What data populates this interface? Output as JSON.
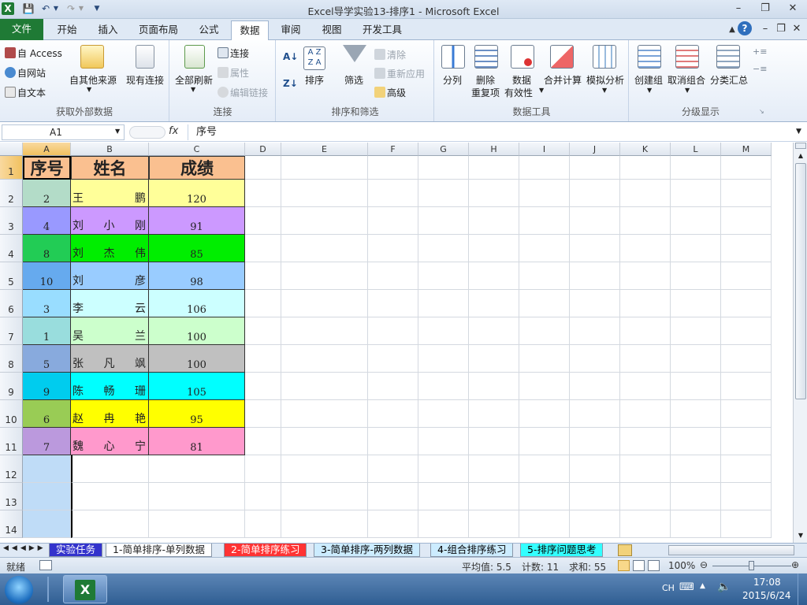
{
  "window": {
    "title": "Excel导学实验13-排序1  -  Microsoft Excel"
  },
  "tabs": [
    {
      "label": "文件"
    },
    {
      "label": "开始"
    },
    {
      "label": "插入"
    },
    {
      "label": "页面布局"
    },
    {
      "label": "公式"
    },
    {
      "label": "数据"
    },
    {
      "label": "审阅"
    },
    {
      "label": "视图"
    },
    {
      "label": "开发工具"
    }
  ],
  "ribbon": {
    "ext": {
      "access": "自 Access",
      "web": "自网站",
      "text": "自文本",
      "other": "自其他来源",
      "existing": "现有连接",
      "label": "获取外部数据"
    },
    "conn": {
      "refresh": "全部刷新",
      "connections": "连接",
      "properties": "属性",
      "edit_links": "编辑链接",
      "label": "连接"
    },
    "sort": {
      "sort": "排序",
      "filter": "筛选",
      "clear": "清除",
      "reapply": "重新应用",
      "advanced": "高级",
      "label": "排序和筛选"
    },
    "tools": {
      "split": "分列",
      "remove_dup_1": "删除",
      "remove_dup_2": "重复项",
      "validation_1": "数据",
      "validation_2": "有效性",
      "consolidate": "合并计算",
      "whatif": "模拟分析",
      "label": "数据工具"
    },
    "outline": {
      "group": "创建组",
      "ungroup": "取消组合",
      "subtotal": "分类汇总",
      "label": "分级显示"
    }
  },
  "formula": {
    "namebox": "A1",
    "fx": "fx",
    "content": "序号"
  },
  "columns": [
    "A",
    "B",
    "C",
    "D",
    "E",
    "F",
    "G",
    "H",
    "I",
    "J",
    "K",
    "L",
    "M"
  ],
  "rows": [
    "1",
    "2",
    "3",
    "4",
    "5",
    "6",
    "7",
    "8",
    "9",
    "10",
    "11",
    "12",
    "13",
    "14"
  ],
  "table": {
    "headers": [
      "序号",
      "姓名",
      "成绩"
    ],
    "header_color": "#fac090",
    "data": [
      {
        "id": "2",
        "name": [
          "王",
          "",
          "鹏"
        ],
        "score": "120",
        "color_a": "#b3dcc8",
        "color_b": "#ffff99",
        "color_c": "#ffff99"
      },
      {
        "id": "4",
        "name": [
          "刘",
          "小",
          "刚"
        ],
        "score": "91",
        "color_a": "#9999ff",
        "color_b": "#cc99ff",
        "color_c": "#cc99ff"
      },
      {
        "id": "8",
        "name": [
          "刘",
          "杰",
          "伟"
        ],
        "score": "85",
        "color_a": "#22cc55",
        "color_b": "#00ee00",
        "color_c": "#00ee00"
      },
      {
        "id": "10",
        "name": [
          "刘",
          "",
          "彦"
        ],
        "score": "98",
        "color_a": "#66aaee",
        "color_b": "#99ccff",
        "color_c": "#99ccff"
      },
      {
        "id": "3",
        "name": [
          "李",
          "",
          "云"
        ],
        "score": "106",
        "color_a": "#99ddff",
        "color_b": "#ccffff",
        "color_c": "#ccffff"
      },
      {
        "id": "1",
        "name": [
          "吴",
          "",
          "兰"
        ],
        "score": "100",
        "color_a": "#99dddd",
        "color_b": "#ccffcc",
        "color_c": "#ccffcc"
      },
      {
        "id": "5",
        "name": [
          "张",
          "凡",
          "飒"
        ],
        "score": "100",
        "color_a": "#88aadd",
        "color_b": "#c0c0c0",
        "color_c": "#c0c0c0"
      },
      {
        "id": "9",
        "name": [
          "陈",
          "畅",
          "珊"
        ],
        "score": "105",
        "color_a": "#00ccee",
        "color_b": "#00ffff",
        "color_c": "#00ffff"
      },
      {
        "id": "6",
        "name": [
          "赵",
          "冉",
          "艳"
        ],
        "score": "95",
        "color_a": "#99cc55",
        "color_b": "#ffff00",
        "color_c": "#ffff00"
      },
      {
        "id": "7",
        "name": [
          "魏",
          "心",
          "宁"
        ],
        "score": "81",
        "color_a": "#bb99dd",
        "color_b": "#ff99cc",
        "color_c": "#ff99cc"
      }
    ]
  },
  "sheets": [
    {
      "label": "实验任务",
      "bg": "#3333cc",
      "fg": "#ffffff"
    },
    {
      "label": "1-简单排序-单列数据",
      "bg": "#ffffff",
      "fg": "#000000"
    },
    {
      "label": "2-简单排序练习",
      "bg": "#ff3333",
      "fg": "#ffffff"
    },
    {
      "label": "3-简单排序-两列数据",
      "bg": "#ccecff",
      "fg": "#000000"
    },
    {
      "label": "4-组合排序练习",
      "bg": "#ccecff",
      "fg": "#000000"
    },
    {
      "label": "5-排序问题思考",
      "bg": "#33ffff",
      "fg": "#000000"
    }
  ],
  "status": {
    "ready": "就绪",
    "average": "平均值: 5.5",
    "count": "计数: 11",
    "sum": "求和: 55",
    "zoom": "100%"
  },
  "taskbar": {
    "lang": "CH",
    "time": "17:08",
    "date": "2015/6/24"
  }
}
